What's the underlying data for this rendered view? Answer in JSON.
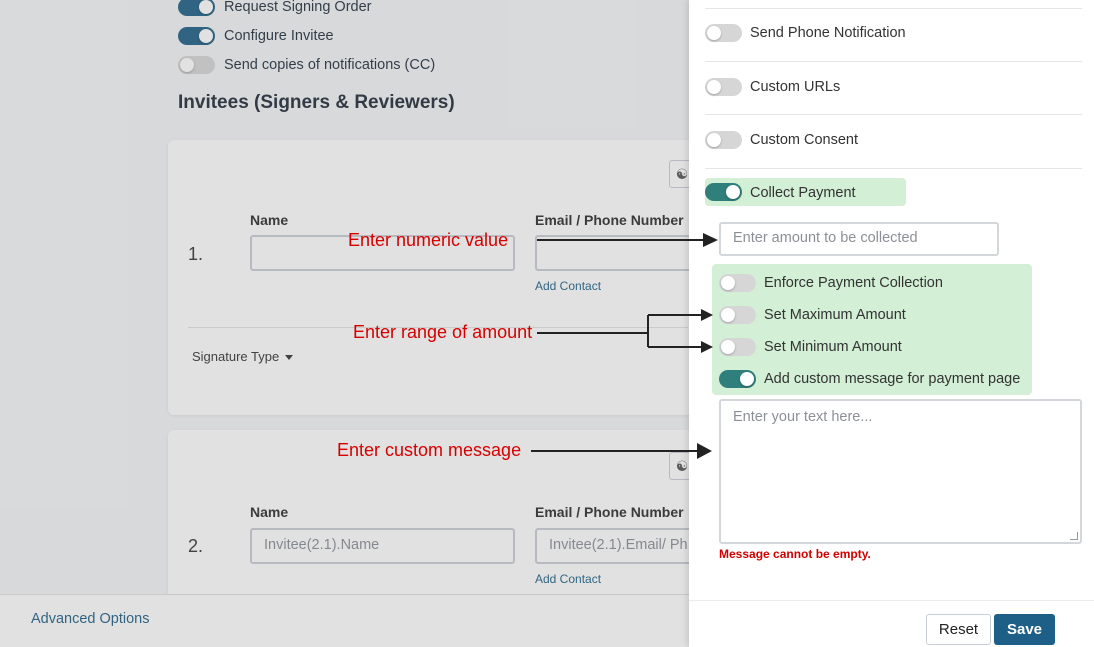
{
  "background": {
    "toggles": [
      {
        "label": "Request Signing Order",
        "on": true
      },
      {
        "label": "Configure Invitee",
        "on": true
      },
      {
        "label": "Send copies of notifications (CC)",
        "on": false
      }
    ],
    "section_heading": "Invitees (Signers & Reviewers)",
    "invitee_1": {
      "number": "1.",
      "name_label": "Name",
      "name_value": "",
      "email_label": "Email / Phone Number",
      "email_value": "",
      "add_contact": "Add Contact",
      "signature_type": "Signature Type"
    },
    "invitee_2": {
      "number": "2.",
      "name_label": "Name",
      "name_placeholder": "Invitee(2.1).Name",
      "email_label": "Email / Phone Number",
      "email_placeholder": "Invitee(2.1).Email/ Ph",
      "add_contact": "Add Contact"
    },
    "advanced_options": "Advanced Options"
  },
  "annotations": {
    "numeric": "Enter numeric value",
    "range": "Enter range of amount",
    "message": "Enter custom message"
  },
  "panel": {
    "send_phone_notification": {
      "label": "Send Phone Notification",
      "on": false
    },
    "custom_urls": {
      "label": "Custom URLs",
      "on": false
    },
    "custom_consent": {
      "label": "Custom Consent",
      "on": false
    },
    "collect_payment": {
      "label": "Collect Payment",
      "on": true
    },
    "amount_placeholder": "Enter amount to be collected",
    "payment_options": [
      {
        "label": "Enforce Payment Collection",
        "on": false
      },
      {
        "label": "Set Maximum Amount",
        "on": false
      },
      {
        "label": "Set Minimum Amount",
        "on": false
      },
      {
        "label": "Add custom message for payment page",
        "on": true
      }
    ],
    "message_placeholder": "Enter your text here...",
    "error": "Message cannot be empty.",
    "reset_label": "Reset",
    "save_label": "Save"
  },
  "colors": {
    "accent": "#1d5f86",
    "teal": "#2f7f7c",
    "highlight_green": "#d3efd6",
    "annotation_red": "#d60000",
    "error_red": "#d10000"
  }
}
